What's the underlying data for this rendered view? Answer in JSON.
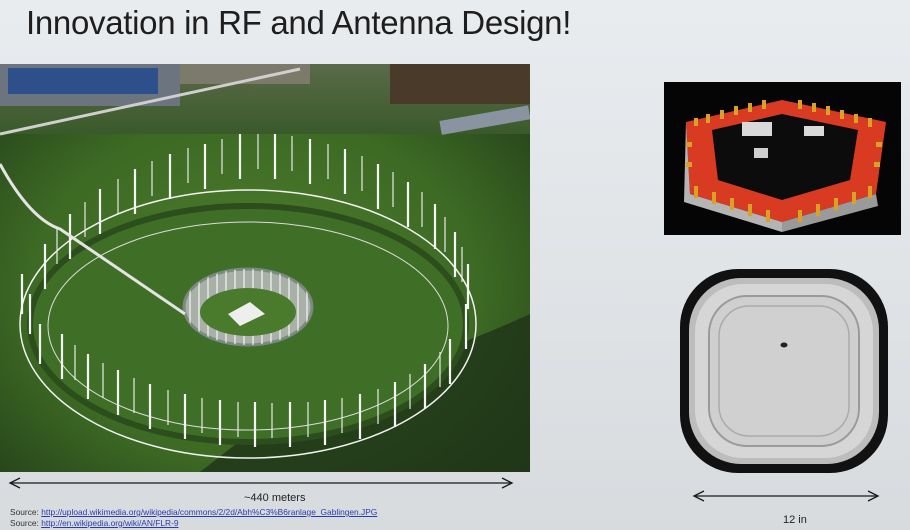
{
  "slide": {
    "title": "Innovation in RF and Antenna Design!"
  },
  "dimensions": {
    "array_label": "~440 meters",
    "ap_label": "12 in"
  },
  "sources": [
    {
      "prefix": "Source: ",
      "link": "http://upload.wikimedia.org/wikipedia/commons/2/2d/Abh%C3%B6ranlage_Gablingen.JPG"
    },
    {
      "prefix": "Source: ",
      "link": "http://en.wikipedia.org/wiki/AN/FLR-9"
    }
  ],
  "colors": {
    "grass": "#3f6b27",
    "pcb_red": "#d93a22",
    "antenna_gold": "#d9a227",
    "ap_grey": "#c9c9c9"
  }
}
